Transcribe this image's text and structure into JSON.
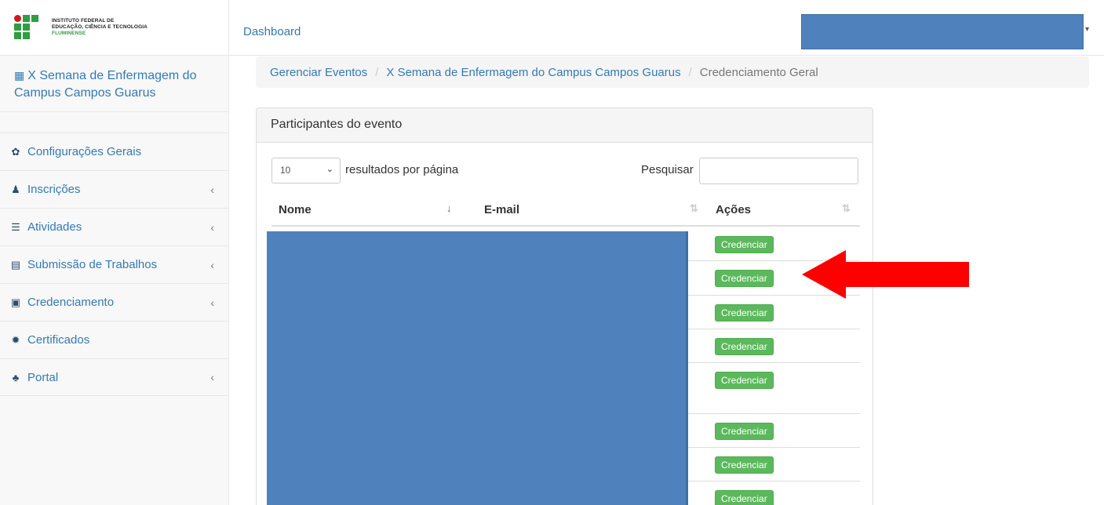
{
  "logo": {
    "line1": "INSTITUTO FEDERAL DE",
    "line2": "EDUCAÇÃO, CIÊNCIA E TECNOLOGIA",
    "line3": "FLUMINENSE"
  },
  "sidebar": {
    "event_title": "X Semana de Enfermagem do Campus Campos Guarus",
    "items": [
      {
        "label": "Configurações Gerais",
        "icon": "gear-icon",
        "glyph": "✿",
        "has_submenu": false
      },
      {
        "label": "Inscrições",
        "icon": "user-icon",
        "glyph": "♟",
        "has_submenu": true
      },
      {
        "label": "Atividades",
        "icon": "tasks-icon",
        "glyph": "☰",
        "has_submenu": true
      },
      {
        "label": "Submissão de Trabalhos",
        "icon": "file-icon",
        "glyph": "▤",
        "has_submenu": true
      },
      {
        "label": "Credenciamento",
        "icon": "badge-icon",
        "glyph": "▣",
        "has_submenu": true
      },
      {
        "label": "Certificados",
        "icon": "certificate-icon",
        "glyph": "✹",
        "has_submenu": false
      },
      {
        "label": "Portal",
        "icon": "sitemap-icon",
        "glyph": "♣",
        "has_submenu": true
      }
    ],
    "chevron": "‹"
  },
  "topbar": {
    "dashboard_label": "Dashboard",
    "caret": "▾"
  },
  "breadcrumb": {
    "items": [
      "Gerenciar Eventos",
      "X Semana de Enfermagem do Campus Campos Guarus"
    ],
    "current": "Credenciamento Geral",
    "separator": "/"
  },
  "panel": {
    "title": "Participantes do evento",
    "length_value": "10",
    "length_label": "resultados por página",
    "search_label": "Pesquisar",
    "search_value": "",
    "columns": [
      "Nome",
      "E-mail",
      "Ações"
    ],
    "sort_active_glyph": "↓",
    "sort_glyph": "⇅",
    "action_label": "Credenciar",
    "row_count": 8
  },
  "colors": {
    "link": "#337ab7",
    "success": "#5cb85c",
    "redaction": "#4f81bd",
    "annotation_arrow": "#ff0000"
  }
}
